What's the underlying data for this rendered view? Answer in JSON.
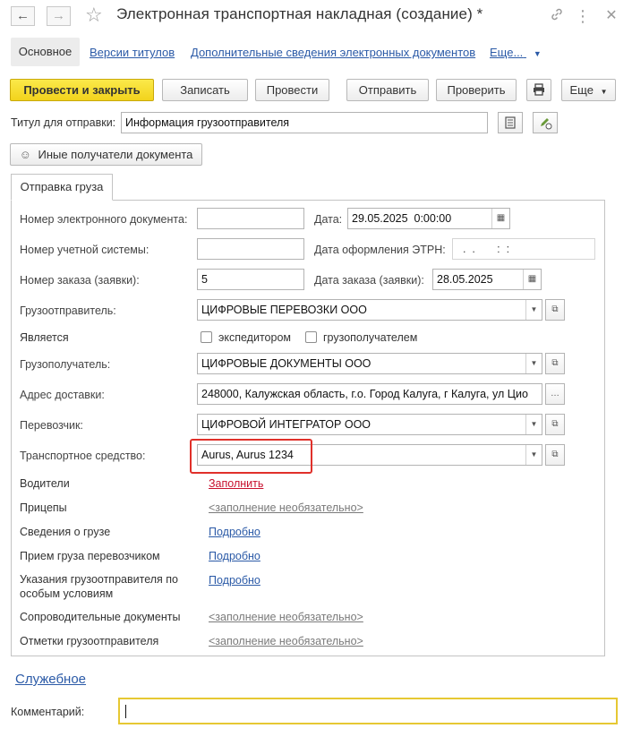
{
  "window": {
    "title": "Электронная транспортная накладная (создание) *",
    "back_icon": "arrow-left-icon",
    "forward_icon": "arrow-right-icon",
    "favorite_icon": "star-icon",
    "link_icon": "link-icon",
    "more_icon": "more-vert-icon",
    "close_icon": "close-icon"
  },
  "nav": {
    "tabs": [
      "Основное",
      "Версии титулов",
      "Дополнительные сведения электронных документов",
      "Еще..."
    ]
  },
  "toolbar": {
    "post_close": "Провести и закрыть",
    "save": "Записать",
    "post": "Провести",
    "send": "Отправить",
    "check": "Проверить",
    "more": "Еще"
  },
  "header": {
    "title_label": "Титул для отправки:",
    "title_value": "Информация грузоотправителя",
    "other_recipients": "Иные получатели документа"
  },
  "tab": {
    "label": "Отправка груза"
  },
  "form": {
    "doc_number_label": "Номер электронного документа:",
    "doc_number_value": "",
    "date_label": "Дата:",
    "date_value": "29.05.2025  0:00:00",
    "acct_number_label": "Номер учетной системы:",
    "acct_number_value": "",
    "etrn_date_label": "Дата оформления ЭТРН:",
    "etrn_date_value": "  .  .       :  :",
    "order_number_label": "Номер заказа (заявки):",
    "order_number_value": "5",
    "order_date_label": "Дата заказа (заявки):",
    "order_date_value": "28.05.2025",
    "shipper_label": "Грузоотправитель:",
    "shipper_value": "ЦИФРОВЫЕ ПЕРЕВОЗКИ ООО",
    "is_label": "Является",
    "forwarder_label": "экспедитором",
    "consignee_cb_label": "грузополучателем",
    "consignee_label": "Грузополучатель:",
    "consignee_value": "ЦИФРОВЫЕ ДОКУМЕНТЫ ООО",
    "address_label": "Адрес доставки:",
    "address_value": "248000, Калужская область, г.о. Город Калуга, г Калуга, ул Цио",
    "carrier_label": "Перевозчик:",
    "carrier_value": "ЦИФРОВОЙ ИНТЕГРАТОР ООО",
    "vehicle_label": "Транспортное средство:",
    "vehicle_value": "Aurus, Aurus 1234",
    "drivers_label": "Водители",
    "drivers_link": "Заполнить",
    "trailers_label": "Прицепы",
    "trailers_link": "<заполнение необязательно>",
    "cargo_label": "Сведения о грузе",
    "cargo_link": "Подробно",
    "acceptance_label": "Прием груза перевозчиком",
    "acceptance_link": "Подробно",
    "instructions_label_1": "Указания грузоотправителя по",
    "instructions_label_2": "особым условиям",
    "instructions_link": "Подробно",
    "docs_label": "Сопроводительные документы",
    "docs_link": "<заполнение необязательно>",
    "marks_label": "Отметки грузоотправителя",
    "marks_link": "<заполнение необязательно>"
  },
  "footer": {
    "service_link": "Служебное",
    "comment_label": "Комментарий:",
    "comment_value": ""
  },
  "colors": {
    "primary_button": "#f2d31c",
    "link": "#2b5aa7",
    "required_link": "#c8102e",
    "highlight": "#e0302a",
    "comment_focus": "#e6c833"
  }
}
